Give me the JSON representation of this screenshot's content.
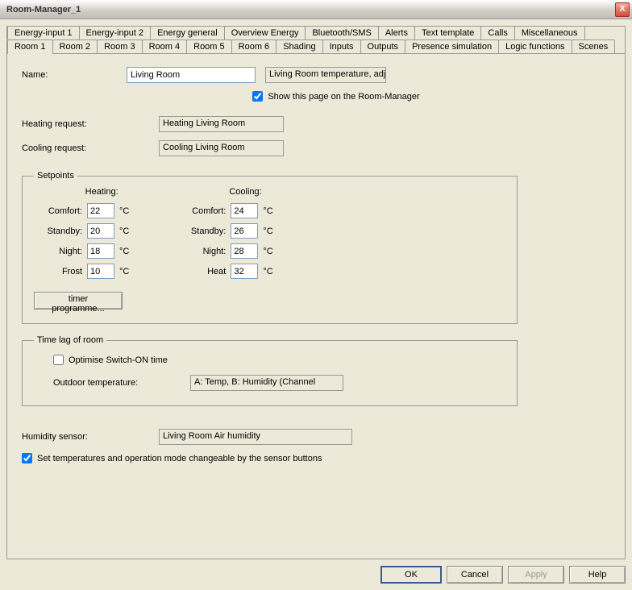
{
  "window": {
    "title": "Room-Manager_1",
    "close_icon": "X"
  },
  "tabs_row1": [
    "Energy-input 1",
    "Energy-input 2",
    "Energy general",
    "Overview Energy",
    "Bluetooth/SMS",
    "Alerts",
    "Text template",
    "Calls",
    "Miscellaneous"
  ],
  "tabs_row2": [
    "Room 1",
    "Room 2",
    "Room 3",
    "Room 4",
    "Room 5",
    "Room 6",
    "Shading",
    "Inputs",
    "Outputs",
    "Presence simulation",
    "Logic functions",
    "Scenes"
  ],
  "active_tab": "Room 1",
  "form": {
    "name_label": "Name:",
    "name_value": "Living Room",
    "name_desc": "Living Room  temperature, adju",
    "show_page_label": "Show this page on the Room-Manager",
    "show_page_checked": true,
    "heating_req_label": "Heating request:",
    "heating_req_value": "Heating Living Room",
    "cooling_req_label": "Cooling request:",
    "cooling_req_value": "Cooling Living Room"
  },
  "setpoints": {
    "legend": "Setpoints",
    "heating_header": "Heating:",
    "cooling_header": "Cooling:",
    "unit": "°C",
    "rows_heating": [
      {
        "label": "Comfort:",
        "value": "22"
      },
      {
        "label": "Standby:",
        "value": "20"
      },
      {
        "label": "Night:",
        "value": "18"
      },
      {
        "label": "Frost",
        "value": "10"
      }
    ],
    "rows_cooling": [
      {
        "label": "Comfort:",
        "value": "24"
      },
      {
        "label": "Standby:",
        "value": "26"
      },
      {
        "label": "Night:",
        "value": "28"
      },
      {
        "label": "Heat",
        "value": "32"
      }
    ],
    "timer_btn": "timer programme..."
  },
  "timelag": {
    "legend": "Time lag of room",
    "optimise_label": "Optimise Switch-ON time",
    "optimise_checked": false,
    "outdoor_label": "Outdoor temperature:",
    "outdoor_value": "A: Temp, B: Humidity  (Channel"
  },
  "humidity": {
    "label": "Humidity sensor:",
    "value": "Living Room  Air humidity"
  },
  "sensor_check": {
    "label": "Set temperatures and operation mode changeable by the sensor buttons",
    "checked": true
  },
  "buttons": {
    "ok": "OK",
    "cancel": "Cancel",
    "apply": "Apply",
    "help": "Help"
  }
}
